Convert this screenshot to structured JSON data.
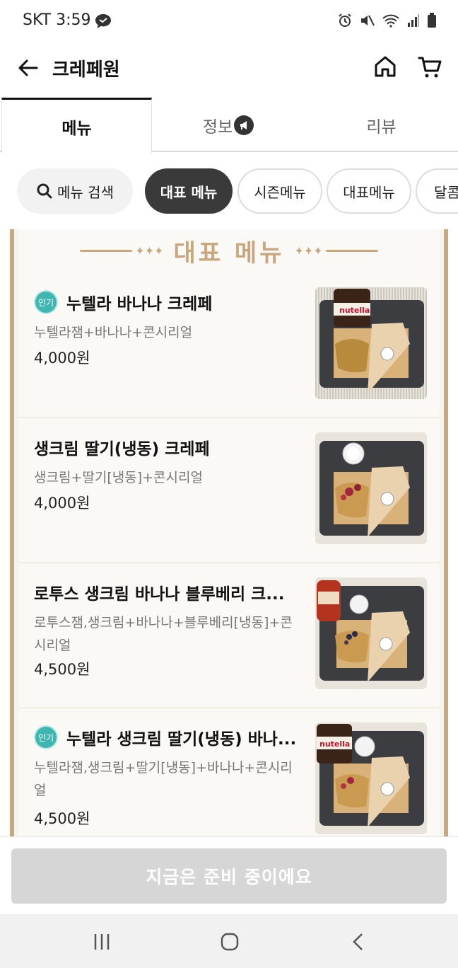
{
  "status": {
    "time": "SKT 3:59"
  },
  "header": {
    "title": "크레페원"
  },
  "tabs": [
    {
      "label": "메뉴"
    },
    {
      "label": "정보"
    },
    {
      "label": "리뷰"
    }
  ],
  "chips": {
    "search_label": "메뉴 검색",
    "items": [
      "대표 메뉴",
      "시즌메뉴",
      "대표메뉴",
      "달콤"
    ]
  },
  "section": {
    "title": "대표 메뉴"
  },
  "menu_items": [
    {
      "badge": "인기",
      "name": "누텔라 바나나 크레페",
      "desc": "누텔라잼+바나나+콘시리얼",
      "price": "4,000원"
    },
    {
      "badge": "",
      "name": "생크림 딸기(냉동) 크레페",
      "desc": "생크림+딸기[냉동]+콘시리얼",
      "price": "4,000원"
    },
    {
      "badge": "",
      "name": "로투스 생크림 바나나 블루베리 크...",
      "desc": "로투스잼,생크림+바나나+블루베리[냉동]+콘시리얼",
      "price": "4,500원"
    },
    {
      "badge": "인기",
      "name": "누텔라 생크림 딸기(냉동) 바나...",
      "desc": "누텔라잼,생크림+딸기[냉동]+바나나+콘시리얼",
      "price": "4,500원"
    }
  ],
  "bottom": {
    "button_label": "지금은 준비 중이에요"
  },
  "colors": {
    "accent_gold": "#c9a77e",
    "badge_teal": "#3fb6b0",
    "active_chip": "#3a3a3a",
    "disabled_button": "#d6d6d6"
  }
}
